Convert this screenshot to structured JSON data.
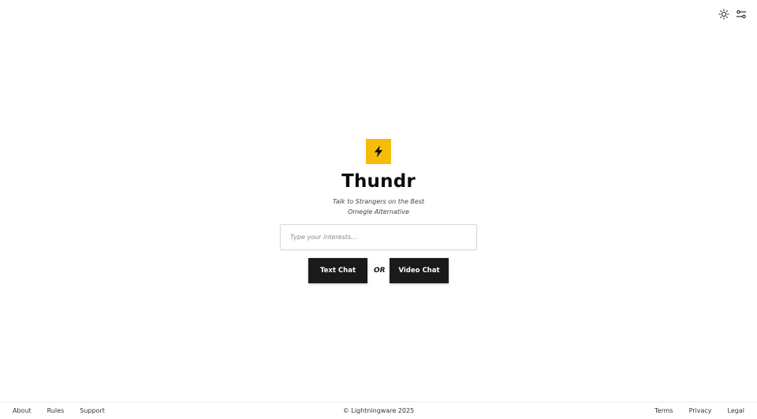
{
  "header": {
    "icons": [
      "sun-icon",
      "sliders-icon"
    ]
  },
  "hero": {
    "logo_icon": "lightning-bolt-icon",
    "brand_color": "#f5bd0b",
    "title": "Thundr",
    "subtitle": "Talk to Strangers on the Best Omegle Alternative",
    "interests_placeholder": "Type your interests...",
    "text_chat_label": "Text Chat",
    "or_label": "OR",
    "video_chat_label": "Video Chat"
  },
  "footer": {
    "left_links": [
      "About",
      "Rules",
      "Support"
    ],
    "copyright": "© Lightningware 2025",
    "right_links": [
      "Terms",
      "Privacy",
      "Legal"
    ]
  }
}
